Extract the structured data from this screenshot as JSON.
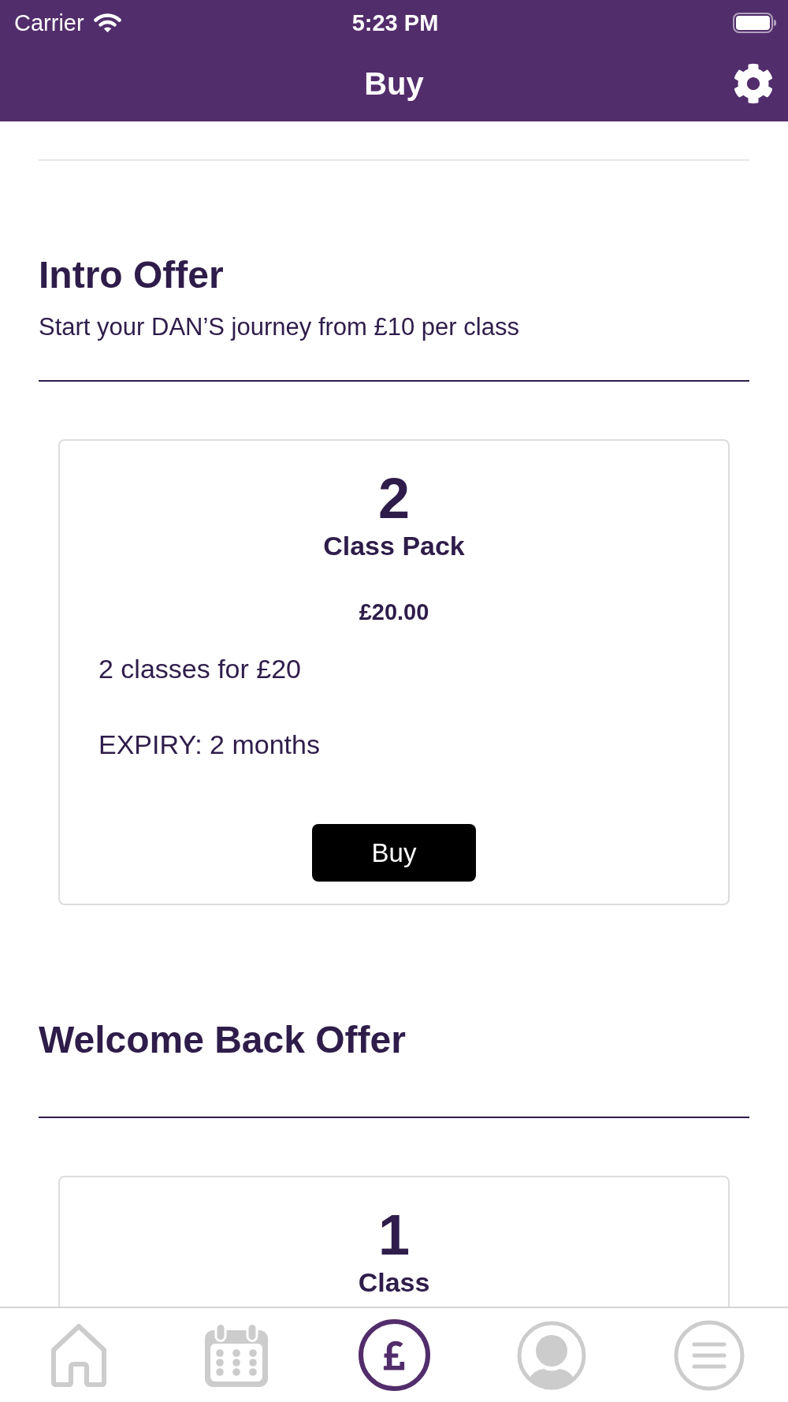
{
  "status_bar": {
    "carrier": "Carrier",
    "time": "5:23 PM"
  },
  "nav_bar": {
    "title": "Buy"
  },
  "sections": [
    {
      "title": "Intro Offer",
      "subtitle": "Start your DAN’S journey from £10 per class",
      "products": [
        {
          "count": "2",
          "name": "Class Pack",
          "price": "£20.00",
          "details": [
            "2 classes for £20",
            "EXPIRY: 2 months"
          ],
          "button": "Buy"
        }
      ]
    },
    {
      "title": "Welcome Back Offer",
      "products": [
        {
          "count": "1",
          "name": "Class"
        }
      ]
    }
  ],
  "tab_bar": {
    "tabs": [
      {
        "kind": "home",
        "selected": false
      },
      {
        "kind": "calendar",
        "selected": false
      },
      {
        "kind": "pound",
        "selected": true
      },
      {
        "kind": "profile",
        "selected": false
      },
      {
        "kind": "menu",
        "selected": false
      }
    ]
  }
}
